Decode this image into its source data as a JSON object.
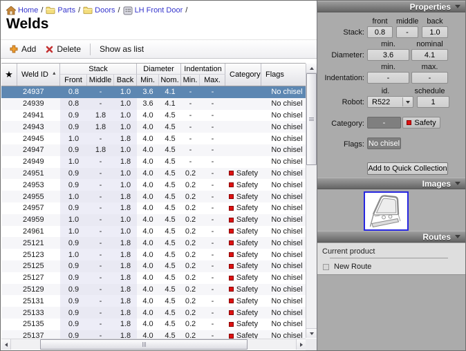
{
  "colors": {
    "selected_row": "#5D87B2",
    "safety_red": "#DD1111",
    "link_blue": "#3333CC",
    "panel_gray": "#ABABAB"
  },
  "breadcrumb": {
    "separator": "/",
    "items": [
      {
        "label": "Home",
        "icon": "home"
      },
      {
        "label": "Parts",
        "icon": "folder"
      },
      {
        "label": "Doors",
        "icon": "folder"
      },
      {
        "label": "LH Front Door",
        "icon": "part"
      }
    ]
  },
  "title": "Welds",
  "toolbar": {
    "add": "Add",
    "delete": "Delete",
    "show_as_list": "Show as list"
  },
  "table": {
    "sort": {
      "column": "Weld ID",
      "direction": "asc"
    },
    "header": {
      "weld_id": "Weld ID",
      "groups": [
        {
          "label": "Stack"
        },
        {
          "label": "Diameter"
        },
        {
          "label": "Indentation"
        }
      ],
      "sub": {
        "front": "Front",
        "middle": "Middle",
        "back": "Back",
        "dmin": "Min.",
        "dnom": "Nom.",
        "imin": "Min.",
        "imax": "Max."
      },
      "category": "Category",
      "flags": "Flags"
    },
    "rows": [
      {
        "id": "24937",
        "front": "0.8",
        "middle": "-",
        "back": "1.0",
        "dmin": "3.6",
        "dnom": "4.1",
        "imin": "-",
        "imax": "-",
        "category": "",
        "flags": "No chisel",
        "selected": true
      },
      {
        "id": "24939",
        "front": "0.8",
        "middle": "-",
        "back": "1.0",
        "dmin": "3.6",
        "dnom": "4.1",
        "imin": "-",
        "imax": "-",
        "category": "",
        "flags": "No chisel"
      },
      {
        "id": "24941",
        "front": "0.9",
        "middle": "1.8",
        "back": "1.0",
        "dmin": "4.0",
        "dnom": "4.5",
        "imin": "-",
        "imax": "-",
        "category": "",
        "flags": "No chisel"
      },
      {
        "id": "24943",
        "front": "0.9",
        "middle": "1.8",
        "back": "1.0",
        "dmin": "4.0",
        "dnom": "4.5",
        "imin": "-",
        "imax": "-",
        "category": "",
        "flags": "No chisel"
      },
      {
        "id": "24945",
        "front": "1.0",
        "middle": "-",
        "back": "1.8",
        "dmin": "4.0",
        "dnom": "4.5",
        "imin": "-",
        "imax": "-",
        "category": "",
        "flags": "No chisel"
      },
      {
        "id": "24947",
        "front": "0.9",
        "middle": "1.8",
        "back": "1.0",
        "dmin": "4.0",
        "dnom": "4.5",
        "imin": "-",
        "imax": "-",
        "category": "",
        "flags": "No chisel"
      },
      {
        "id": "24949",
        "front": "1.0",
        "middle": "-",
        "back": "1.8",
        "dmin": "4.0",
        "dnom": "4.5",
        "imin": "-",
        "imax": "-",
        "category": "",
        "flags": "No chisel"
      },
      {
        "id": "24951",
        "front": "0.9",
        "middle": "-",
        "back": "1.0",
        "dmin": "4.0",
        "dnom": "4.5",
        "imin": "0.2",
        "imax": "-",
        "category": "Safety",
        "flags": "No chisel"
      },
      {
        "id": "24953",
        "front": "0.9",
        "middle": "-",
        "back": "1.0",
        "dmin": "4.0",
        "dnom": "4.5",
        "imin": "0.2",
        "imax": "-",
        "category": "Safety",
        "flags": "No chisel"
      },
      {
        "id": "24955",
        "front": "1.0",
        "middle": "-",
        "back": "1.8",
        "dmin": "4.0",
        "dnom": "4.5",
        "imin": "0.2",
        "imax": "-",
        "category": "Safety",
        "flags": "No chisel"
      },
      {
        "id": "24957",
        "front": "0.9",
        "middle": "-",
        "back": "1.8",
        "dmin": "4.0",
        "dnom": "4.5",
        "imin": "0.2",
        "imax": "-",
        "category": "Safety",
        "flags": "No chisel"
      },
      {
        "id": "24959",
        "front": "1.0",
        "middle": "-",
        "back": "1.0",
        "dmin": "4.0",
        "dnom": "4.5",
        "imin": "0.2",
        "imax": "-",
        "category": "Safety",
        "flags": "No chisel"
      },
      {
        "id": "24961",
        "front": "1.0",
        "middle": "-",
        "back": "1.0",
        "dmin": "4.0",
        "dnom": "4.5",
        "imin": "0.2",
        "imax": "-",
        "category": "Safety",
        "flags": "No chisel"
      },
      {
        "id": "25121",
        "front": "0.9",
        "middle": "-",
        "back": "1.8",
        "dmin": "4.0",
        "dnom": "4.5",
        "imin": "0.2",
        "imax": "-",
        "category": "Safety",
        "flags": "No chisel"
      },
      {
        "id": "25123",
        "front": "1.0",
        "middle": "-",
        "back": "1.8",
        "dmin": "4.0",
        "dnom": "4.5",
        "imin": "0.2",
        "imax": "-",
        "category": "Safety",
        "flags": "No chisel"
      },
      {
        "id": "25125",
        "front": "0.9",
        "middle": "-",
        "back": "1.8",
        "dmin": "4.0",
        "dnom": "4.5",
        "imin": "0.2",
        "imax": "-",
        "category": "Safety",
        "flags": "No chisel"
      },
      {
        "id": "25127",
        "front": "0.9",
        "middle": "-",
        "back": "1.8",
        "dmin": "4.0",
        "dnom": "4.5",
        "imin": "0.2",
        "imax": "-",
        "category": "Safety",
        "flags": "No chisel"
      },
      {
        "id": "25129",
        "front": "0.9",
        "middle": "-",
        "back": "1.8",
        "dmin": "4.0",
        "dnom": "4.5",
        "imin": "0.2",
        "imax": "-",
        "category": "Safety",
        "flags": "No chisel"
      },
      {
        "id": "25131",
        "front": "0.9",
        "middle": "-",
        "back": "1.8",
        "dmin": "4.0",
        "dnom": "4.5",
        "imin": "0.2",
        "imax": "-",
        "category": "Safety",
        "flags": "No chisel"
      },
      {
        "id": "25133",
        "front": "0.9",
        "middle": "-",
        "back": "1.8",
        "dmin": "4.0",
        "dnom": "4.5",
        "imin": "0.2",
        "imax": "-",
        "category": "Safety",
        "flags": "No chisel"
      },
      {
        "id": "25135",
        "front": "0.9",
        "middle": "-",
        "back": "1.8",
        "dmin": "4.0",
        "dnom": "4.5",
        "imin": "0.2",
        "imax": "-",
        "category": "Safety",
        "flags": "No chisel"
      },
      {
        "id": "25137",
        "front": "0.9",
        "middle": "-",
        "back": "1.8",
        "dmin": "4.0",
        "dnom": "4.5",
        "imin": "0.2",
        "imax": "-",
        "category": "Safety",
        "flags": "No chisel"
      }
    ]
  },
  "properties": {
    "header": "Properties",
    "stack": {
      "label": "Stack:",
      "fields": [
        {
          "label": "front",
          "value": "0.8"
        },
        {
          "label": "middle",
          "value": "-"
        },
        {
          "label": "back",
          "value": "1.0"
        }
      ]
    },
    "diameter": {
      "label": "Diameter:",
      "fields": [
        {
          "label": "min.",
          "value": "3.6"
        },
        {
          "label": "nominal",
          "value": "4.1"
        }
      ]
    },
    "indentation": {
      "label": "Indentation:",
      "fields": [
        {
          "label": "min.",
          "value": "-"
        },
        {
          "label": "max.",
          "value": "-"
        }
      ]
    },
    "robot": {
      "label": "Robot:",
      "fields": [
        {
          "label": "id.",
          "value": "R522"
        },
        {
          "label": "schedule",
          "value": "1"
        }
      ]
    },
    "category": {
      "label": "Category:",
      "none_value": "-",
      "safety_label": "Safety"
    },
    "flags": {
      "label": "Flags:",
      "value": "No chisel"
    },
    "quick_collection_button": "Add to Quick Collection"
  },
  "images": {
    "header": "Images"
  },
  "routes": {
    "header": "Routes",
    "group_label": "Current product",
    "items": [
      {
        "label": "New Route",
        "checked": false
      }
    ]
  }
}
